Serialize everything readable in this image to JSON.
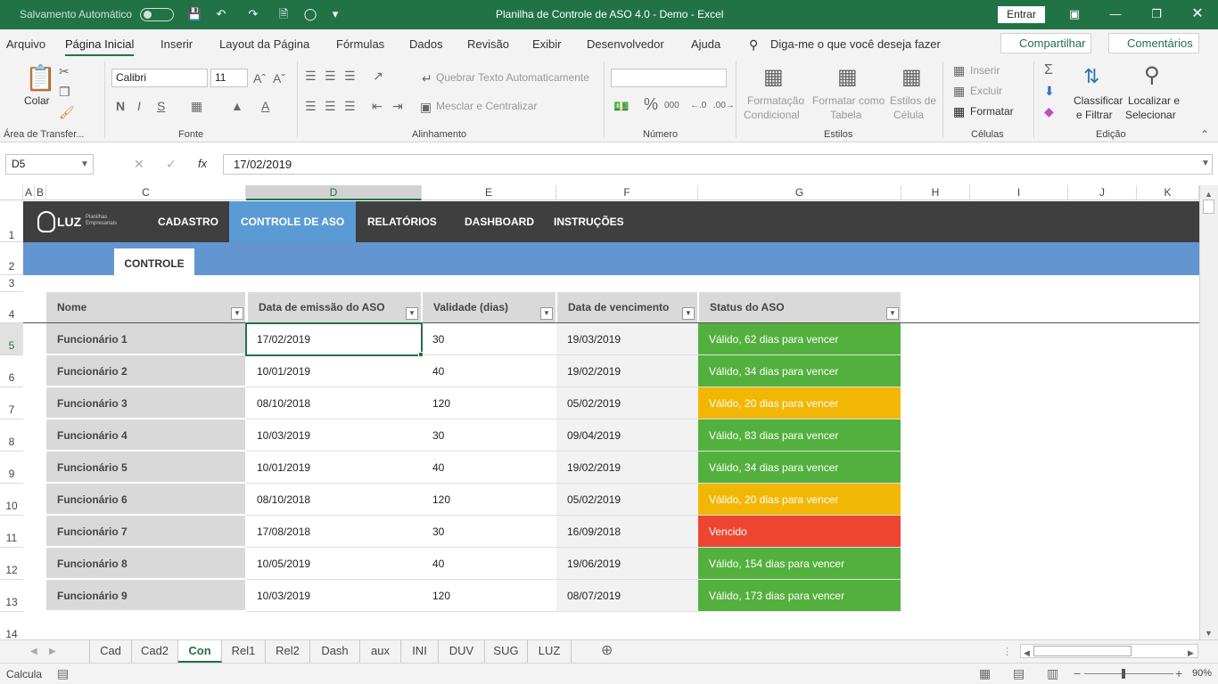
{
  "titlebar": {
    "autosave_label": "Salvamento Automático",
    "window_title": "Planilha de Controle de ASO 4.0 - Demo  -  Excel",
    "signin_label": "Entrar"
  },
  "menu": {
    "items": [
      "Arquivo",
      "Página Inicial",
      "Inserir",
      "Layout da Página",
      "Fórmulas",
      "Dados",
      "Revisão",
      "Exibir",
      "Desenvolvedor",
      "Ajuda"
    ],
    "search": "Diga-me o que você deseja fazer",
    "share": "Compartilhar",
    "comments": "Comentários"
  },
  "ribbon": {
    "clipboard": {
      "paste": "Colar",
      "label": "Área de Transfer..."
    },
    "font": {
      "name": "Calibri",
      "size": "11",
      "label": "Fonte"
    },
    "alignment": {
      "wrap": "Quebrar Texto Automaticamente",
      "merge": "Mesclar e Centralizar",
      "label": "Alinhamento"
    },
    "number": {
      "format": "",
      "label": "Número"
    },
    "styles": {
      "conditional_a": "Formatação",
      "conditional_b": "Condicional",
      "table_a": "Formatar como",
      "table_b": "Tabela",
      "cell_a": "Estilos de",
      "cell_b": "Célula",
      "label": "Estilos"
    },
    "cells": {
      "insert": "Inserir",
      "delete": "Excluir",
      "format": "Formatar",
      "label": "Células"
    },
    "editing": {
      "sort_a": "Classificar",
      "sort_b": "e Filtrar",
      "find_a": "Localizar e",
      "find_b": "Selecionar",
      "label": "Edição"
    }
  },
  "formula_bar": {
    "name_box": "D5",
    "fx": "fx",
    "value": "17/02/2019"
  },
  "columns": [
    "A",
    "B",
    "C",
    "D",
    "E",
    "F",
    "G",
    "H",
    "I",
    "J",
    "K"
  ],
  "rows": [
    "1",
    "2",
    "3",
    "4",
    "5",
    "6",
    "7",
    "8",
    "9",
    "10",
    "11",
    "12",
    "13",
    "14"
  ],
  "nav": {
    "logo": "LUZ",
    "logo_sub_a": "Planilhas",
    "logo_sub_b": "Empresariais",
    "items": [
      "CADASTRO",
      "CONTROLE DE ASO",
      "RELATÓRIOS",
      "DASHBOARD",
      "INSTRUÇÕES"
    ],
    "active": "CONTROLE DE ASO",
    "subtab": "CONTROLE"
  },
  "table": {
    "headers": [
      "Nome",
      "Data de emissão do ASO",
      "Validade (dias)",
      "Data de vencimento",
      "Status do ASO"
    ],
    "rows": [
      {
        "name": "Funcionário 1",
        "emissao": "17/02/2019",
        "validade": "30",
        "vencimento": "19/03/2019",
        "status": "Válido, 62 dias para vencer",
        "color": "#54b03e"
      },
      {
        "name": "Funcionário 2",
        "emissao": "10/01/2019",
        "validade": "40",
        "vencimento": "19/02/2019",
        "status": "Válido, 34 dias para vencer",
        "color": "#54b03e"
      },
      {
        "name": "Funcionário 3",
        "emissao": "08/10/2018",
        "validade": "120",
        "vencimento": "05/02/2019",
        "status": "Válido, 20 dias para vencer",
        "color": "#f2b705"
      },
      {
        "name": "Funcionário 4",
        "emissao": "10/03/2019",
        "validade": "30",
        "vencimento": "09/04/2019",
        "status": "Válido, 83 dias para vencer",
        "color": "#54b03e"
      },
      {
        "name": "Funcionário 5",
        "emissao": "10/01/2019",
        "validade": "40",
        "vencimento": "19/02/2019",
        "status": "Válido, 34 dias para vencer",
        "color": "#54b03e"
      },
      {
        "name": "Funcionário 6",
        "emissao": "08/10/2018",
        "validade": "120",
        "vencimento": "05/02/2019",
        "status": "Válido, 20 dias para vencer",
        "color": "#f2b705"
      },
      {
        "name": "Funcionário 7",
        "emissao": "17/08/2018",
        "validade": "30",
        "vencimento": "16/09/2018",
        "status": "Vencido",
        "color": "#ee4530"
      },
      {
        "name": "Funcionário 8",
        "emissao": "10/05/2019",
        "validade": "40",
        "vencimento": "19/06/2019",
        "status": "Válido, 154 dias para vencer",
        "color": "#54b03e"
      },
      {
        "name": "Funcionário 9",
        "emissao": "10/03/2019",
        "validade": "120",
        "vencimento": "08/07/2019",
        "status": "Válido, 173 dias para vencer",
        "color": "#54b03e"
      }
    ]
  },
  "sheets": [
    "Cad",
    "Cad2",
    "Con",
    "Rel1",
    "Rel2",
    "Dash",
    "aux",
    "INI",
    "DUV",
    "SUG",
    "LUZ"
  ],
  "active_sheet": "Con",
  "status": {
    "mode": "Calcula",
    "zoom": "90%"
  }
}
